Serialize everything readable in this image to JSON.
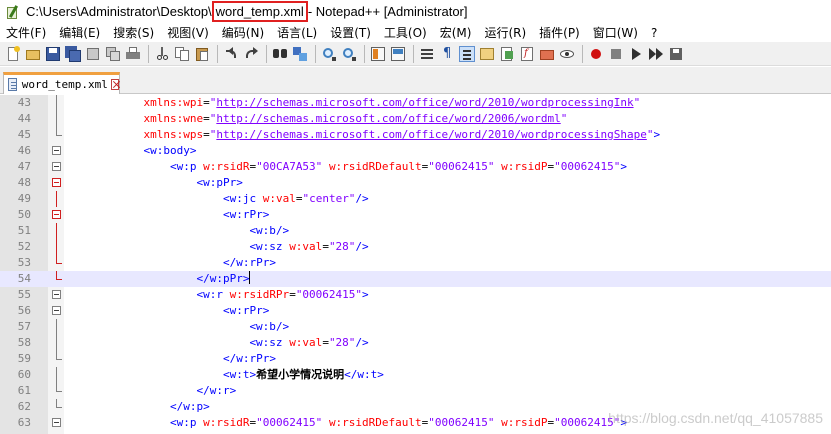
{
  "window": {
    "title_prefix": "C:\\Users\\Administrator\\Desktop\\",
    "title_file": "word_temp.xml",
    "title_suffix": " - Notepad++ [Administrator]"
  },
  "menu": {
    "file": "文件(F)",
    "edit": "编辑(E)",
    "search": "搜索(S)",
    "view": "视图(V)",
    "encoding": "编码(N)",
    "language": "语言(L)",
    "settings": "设置(T)",
    "tools": "工具(O)",
    "macro": "宏(M)",
    "run": "运行(R)",
    "plugins": "插件(P)",
    "window": "窗口(W)",
    "help": "?"
  },
  "tab": {
    "label": "word_temp.xml"
  },
  "lines": [
    {
      "n": "43",
      "code": "            xmlns:wpi=\"http://schemas.microsoft.com/office/word/2010/wordprocessingInk\""
    },
    {
      "n": "44",
      "code": "            xmlns:wne=\"http://schemas.microsoft.com/office/word/2006/wordml\""
    },
    {
      "n": "45",
      "code": "            xmlns:wps=\"http://schemas.microsoft.com/office/word/2010/wordprocessingShape\">"
    },
    {
      "n": "46",
      "code": "            <w:body>"
    },
    {
      "n": "47",
      "code": "                <w:p w:rsidR=\"00CA7A53\" w:rsidRDefault=\"00062415\" w:rsidP=\"00062415\">"
    },
    {
      "n": "48",
      "code": "                    <w:pPr>"
    },
    {
      "n": "49",
      "code": "                        <w:jc w:val=\"center\"/>"
    },
    {
      "n": "50",
      "code": "                        <w:rPr>"
    },
    {
      "n": "51",
      "code": "                            <w:b/>"
    },
    {
      "n": "52",
      "code": "                            <w:sz w:val=\"28\"/>"
    },
    {
      "n": "53",
      "code": "                        </w:rPr>"
    },
    {
      "n": "54",
      "code": "                    </w:pPr>"
    },
    {
      "n": "55",
      "code": "                    <w:r w:rsidRPr=\"00062415\">"
    },
    {
      "n": "56",
      "code": "                        <w:rPr>"
    },
    {
      "n": "57",
      "code": "                            <w:b/>"
    },
    {
      "n": "58",
      "code": "                            <w:sz w:val=\"28\"/>"
    },
    {
      "n": "59",
      "code": "                        </w:rPr>"
    },
    {
      "n": "60",
      "code": "                        <w:t>希望小学情况说明</w:t>"
    },
    {
      "n": "61",
      "code": "                    </w:r>"
    },
    {
      "n": "62",
      "code": "                </w:p>"
    },
    {
      "n": "63",
      "code": "                <w:p w:rsidR=\"00062415\" w:rsidRDefault=\"00062415\" w:rsidP=\"00062415\">"
    }
  ],
  "watermark": "https://blog.csdn.net/qq_41057885",
  "colors": {
    "tag": "#0000ff",
    "attr": "#ff0000",
    "value": "#8000ff",
    "gutter": "#e4e4e4",
    "highlight_box": "#e02020",
    "tab_accent": "#f0a040"
  }
}
